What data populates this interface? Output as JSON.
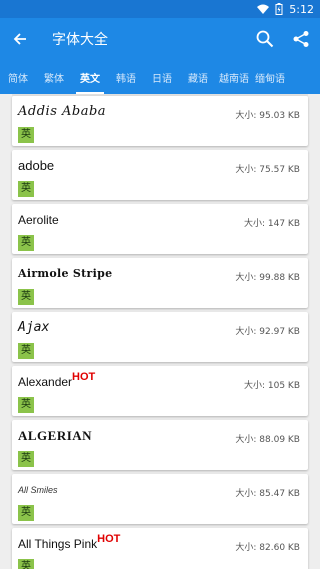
{
  "status": {
    "time": "5:12"
  },
  "appbar": {
    "title": "字体大全"
  },
  "tabs": [
    "简体",
    "繁体",
    "英文",
    "韩语",
    "日语",
    "藏语",
    "越南语",
    "缅甸语"
  ],
  "active_tab": "英文",
  "colors": {
    "primary": "#1e88e5",
    "status": "#1976d2",
    "tag": "#8bc34a",
    "hot": "#e00000"
  },
  "fonts": [
    {
      "name": "Addis Ababa",
      "hot": "",
      "tag": "英",
      "size": "大小: 95.03 KB"
    },
    {
      "name": "adobe",
      "hot": "",
      "tag": "英",
      "size": "大小: 75.57 KB"
    },
    {
      "name": "Aerolite",
      "hot": "",
      "tag": "英",
      "size": "大小: 147 KB"
    },
    {
      "name": "Airmole Stripe",
      "hot": "",
      "tag": "英",
      "size": "大小: 99.88 KB"
    },
    {
      "name": "Ajax",
      "hot": "",
      "tag": "英",
      "size": "大小: 92.97 KB"
    },
    {
      "name": "Alexander",
      "hot": "HOT",
      "tag": "英",
      "size": "大小: 105 KB"
    },
    {
      "name": "ALGERIAN",
      "hot": "",
      "tag": "英",
      "size": "大小: 88.09 KB"
    },
    {
      "name": "All Smiles",
      "hot": "",
      "tag": "英",
      "size": "大小: 85.47 KB"
    },
    {
      "name": "All Things Pink",
      "hot": "HOT",
      "tag": "英",
      "size": "大小: 82.60 KB"
    }
  ]
}
